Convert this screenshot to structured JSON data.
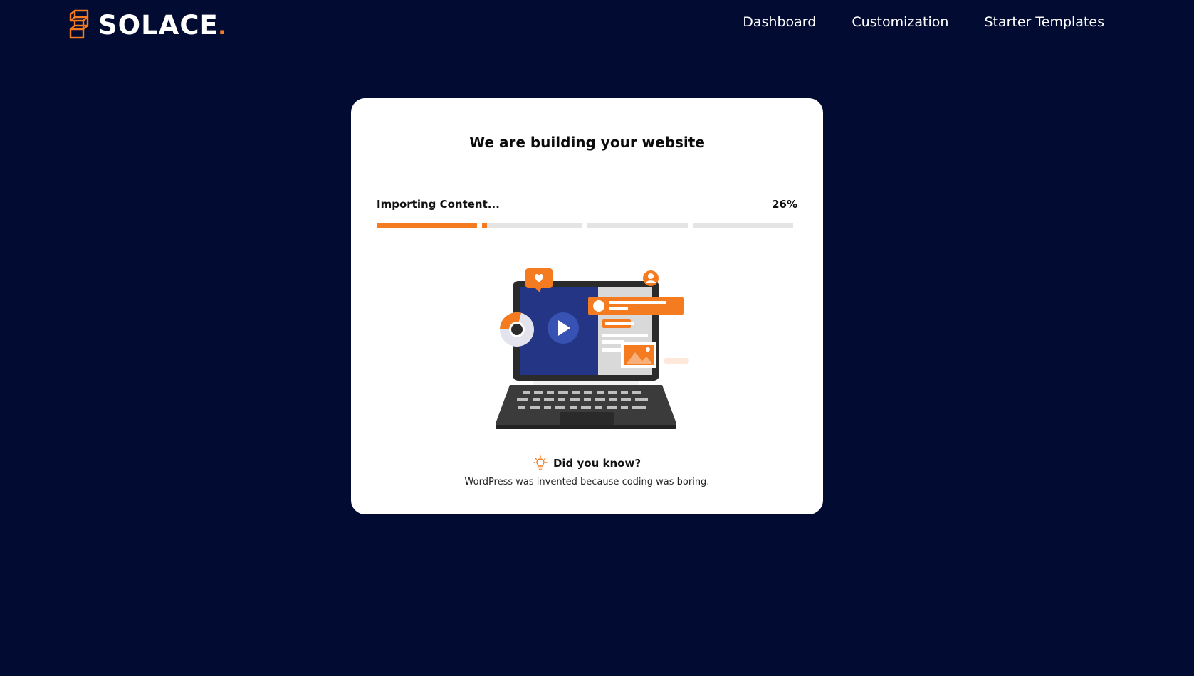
{
  "brand": {
    "name": "SOLACE",
    "dot": ".",
    "accent_color": "#f47b20",
    "background_color": "#020b32"
  },
  "nav": {
    "items": [
      {
        "label": "Dashboard"
      },
      {
        "label": "Customization"
      },
      {
        "label": "Starter Templates"
      }
    ]
  },
  "card": {
    "title": "We are building your website",
    "status_label": "Importing Content...",
    "progress_text": "26%",
    "progress_segments": [
      1.0,
      0.05,
      0.0,
      0.0
    ],
    "tip_title": "Did you know?",
    "tip_text": "WordPress was invented because coding was boring.",
    "illustration_icon": "laptop-website-illustration",
    "tip_icon": "lightbulb-icon"
  }
}
